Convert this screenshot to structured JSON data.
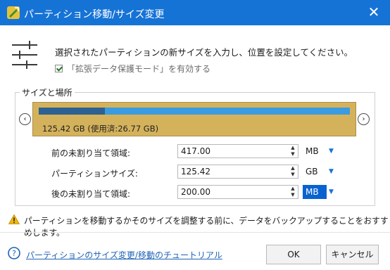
{
  "window": {
    "title": "パーティション移動/サイズ変更",
    "close_label": "✕"
  },
  "header": {
    "instruction": "選択されたパーティションの新サイズを入力し、位置を設定してください。",
    "checkbox_label": "「拡張データ保護モード」を有効する",
    "checkbox_checked": true
  },
  "group": {
    "title": "サイズと場所",
    "partition_label": "125.42 GB (使用済:26.77 GB)",
    "used_fraction": 0.213,
    "nav_left": "‹",
    "nav_right": "›"
  },
  "fields": [
    {
      "label": "前の未割り当て領域:",
      "value": "417.00",
      "unit": "MB",
      "selected": false
    },
    {
      "label": "パーティションサイズ:",
      "value": "125.42",
      "unit": "GB",
      "selected": false
    },
    {
      "label": "後の未割り当て領域:",
      "value": "200.00",
      "unit": "MB",
      "selected": true
    }
  ],
  "warning": "パーティションを移動するかそのサイズを調整する前に、データをバックアップすることをおすすめします。",
  "footer": {
    "help_link": "パーティションのサイズ変更/移動のチュートリアル",
    "ok_label": "OK",
    "cancel_label": "キャンセル"
  },
  "colors": {
    "titlebar": "#1673d6",
    "partition_fill": "#d4b25c",
    "bar_free": "#3a9be0",
    "bar_used": "#2c6191",
    "unit_selected": "#0a62cf"
  }
}
